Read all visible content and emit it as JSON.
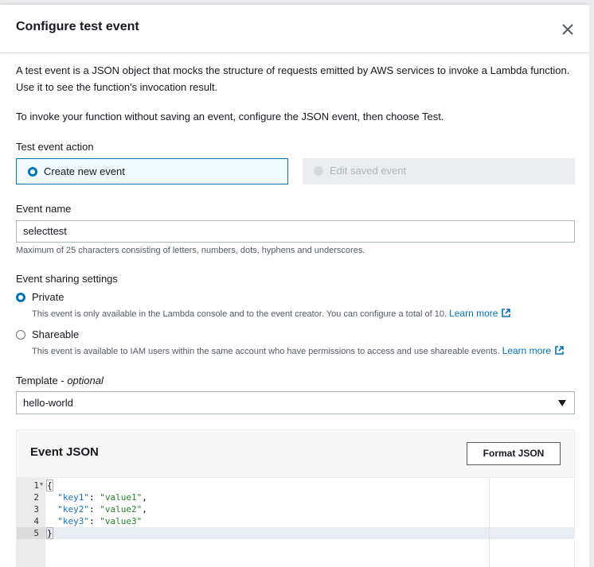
{
  "modal": {
    "title": "Configure test event",
    "close_icon": "close-icon"
  },
  "intro": {
    "line1": "A test event is a JSON object that mocks the structure of requests emitted by AWS services to invoke a Lambda function.",
    "line2": "Use it to see the function's invocation result.",
    "line3": "To invoke your function without saving an event, configure the JSON event, then choose Test."
  },
  "test_event_action": {
    "label": "Test event action",
    "options": [
      {
        "label": "Create new event",
        "selected": true,
        "disabled": false
      },
      {
        "label": "Edit saved event",
        "selected": false,
        "disabled": true
      }
    ]
  },
  "event_name": {
    "label": "Event name",
    "value": "selecttest",
    "hint": "Maximum of 25 characters consisting of letters, numbers, dots, hyphens and underscores."
  },
  "sharing": {
    "label": "Event sharing settings",
    "private": {
      "label": "Private",
      "selected": true,
      "description": "This event is only available in the Lambda console and to the event creator. You can configure a total of 10.",
      "link": "Learn more"
    },
    "shareable": {
      "label": "Shareable",
      "selected": false,
      "description": "This event is available to IAM users within the same account who have permissions to access and use shareable events.",
      "link": "Learn more"
    }
  },
  "template": {
    "label": "Template",
    "label_suffix": "optional",
    "value": "hello-world"
  },
  "event_json": {
    "title": "Event JSON",
    "format_button": "Format JSON",
    "line_numbers": [
      "1",
      "2",
      "3",
      "4",
      "5"
    ],
    "lines": [
      {
        "open": "{"
      },
      {
        "key": "\"key1\"",
        "sep": ": ",
        "val": "\"value1\"",
        "end": ","
      },
      {
        "key": "\"key2\"",
        "sep": ": ",
        "val": "\"value2\"",
        "end": ","
      },
      {
        "key": "\"key3\"",
        "sep": ": ",
        "val": "\"value3\"",
        "end": ""
      },
      {
        "close": "}"
      }
    ]
  },
  "colors": {
    "accent": "#0073bb",
    "link": "#0073bb",
    "selected_tile_bg": "#f1faff",
    "disabled_tile_bg": "#eaeded"
  }
}
